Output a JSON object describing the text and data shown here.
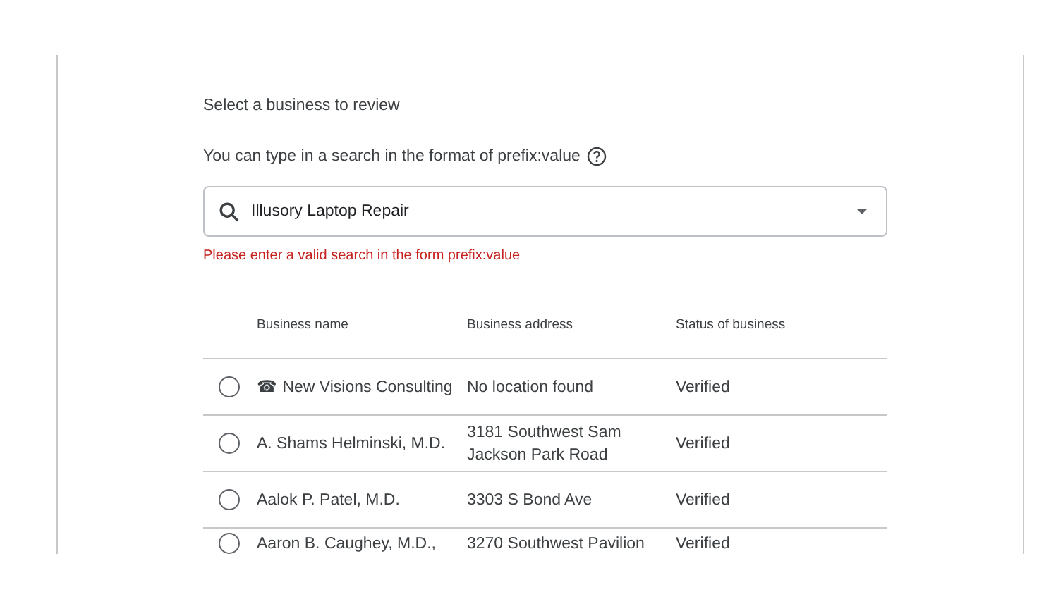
{
  "intro": "Select a business to review",
  "hint": {
    "text": "You can type in a search in the format of prefix:value"
  },
  "search": {
    "value": "Illusory Laptop Repair",
    "error": "Please enter a valid search in the form prefix:value"
  },
  "table": {
    "columns": [
      "Business name",
      "Business address",
      "Status of business"
    ],
    "rows": [
      {
        "selected": false,
        "name": "☎ New Visions Consulting",
        "address": "No location found",
        "status": "Verified"
      },
      {
        "selected": false,
        "name": "A. Shams Helminski, M.D.",
        "address": "3181 Southwest Sam Jackson Park Road",
        "status": "Verified"
      },
      {
        "selected": false,
        "name": "Aalok P. Patel, M.D.",
        "address": "3303 S Bond Ave",
        "status": "Verified"
      },
      {
        "selected": false,
        "name": "Aaron B. Caughey, M.D.,",
        "address": "3270 Southwest Pavilion",
        "status": "Verified"
      }
    ]
  }
}
